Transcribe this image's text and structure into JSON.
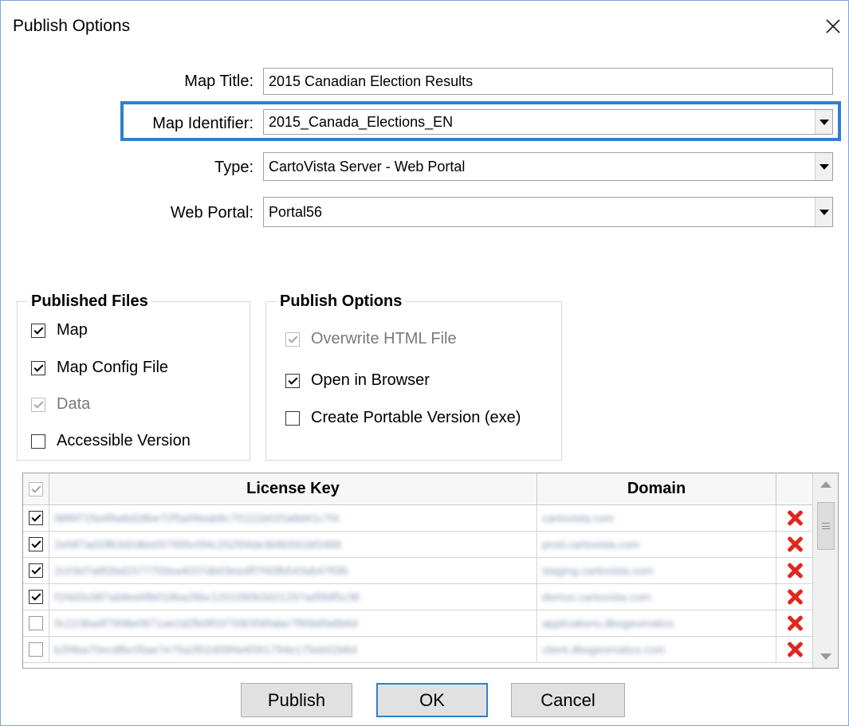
{
  "window": {
    "title": "Publish Options"
  },
  "form": {
    "map_title_label": "Map Title:",
    "map_title_value": "2015 Canadian Election Results",
    "map_identifier_label": "Map Identifier:",
    "map_identifier_value": "2015_Canada_Elections_EN",
    "type_label": "Type:",
    "type_value": "CartoVista Server - Web Portal",
    "web_portal_label": "Web Portal:",
    "web_portal_value": "Portal56"
  },
  "published_files": {
    "title": "Published Files",
    "items": [
      {
        "label": "Map",
        "checked": true,
        "disabled": false
      },
      {
        "label": "Map Config File",
        "checked": true,
        "disabled": false
      },
      {
        "label": "Data",
        "checked": true,
        "disabled": true
      },
      {
        "label": "Accessible Version",
        "checked": false,
        "disabled": false
      }
    ]
  },
  "publish_options": {
    "title": "Publish Options",
    "items": [
      {
        "label": "Overwrite HTML File",
        "checked": true,
        "disabled": true
      },
      {
        "label": "Open in Browser",
        "checked": true,
        "disabled": false
      },
      {
        "label": "Create Portable Version (exe)",
        "checked": false,
        "disabled": false
      }
    ]
  },
  "license_table": {
    "columns": [
      "License Key",
      "Domain"
    ],
    "header_checkbox": {
      "checked": true,
      "disabled": true
    },
    "rows": [
      {
        "checked": true,
        "key": "98f6f72fa4f9a6d28be72f5a09eab6c7f1111b020a8d41c7f4",
        "domain": "cartovista.com"
      },
      {
        "checked": true,
        "key": "2ef4f7ad1ff63d2dbe057995c0f4c2025f4de3b6b591bf3486",
        "domain": "prod.cartovista.com"
      },
      {
        "checked": true,
        "key": "2c03d7a8f2bd2377755ea4037db03ea4ff7f40fb543ab47f5fb",
        "domain": "staging.cartovista.com"
      },
      {
        "checked": true,
        "key": "f1f4d3c987ab8ed4fb018ba26bc1201090b3421297ad5fdf5c36",
        "domain": "demos.cartovista.com"
      },
      {
        "checked": false,
        "key": "5c2236a4f7998e0671ae2d2fb9f037336356fabe7f95b6fa6b6d",
        "domain": "applications.dbogeomatics"
      },
      {
        "checked": false,
        "key": "b2f4ba70ecdfbc05ae7e75a2f02d09f4e6561794e175eb02b6d",
        "domain": "client.dbogeomatics.com"
      }
    ]
  },
  "buttons": {
    "publish": "Publish",
    "ok": "OK",
    "cancel": "Cancel"
  },
  "icons": {
    "close": "close-icon",
    "remove": "remove-x-icon",
    "dropdown": "chevron-down-icon"
  },
  "colors": {
    "accent": "#2f7fd1",
    "remove": "#e0281e"
  }
}
